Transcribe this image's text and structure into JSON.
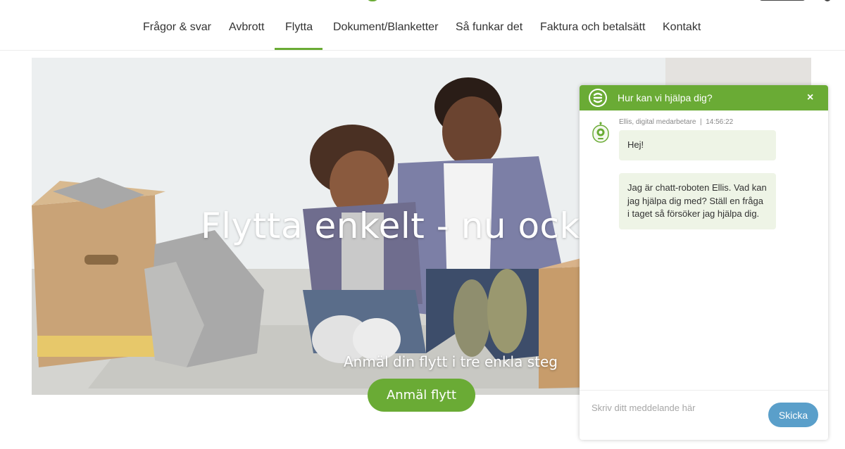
{
  "nav": {
    "items": [
      {
        "label": "Frågor & svar"
      },
      {
        "label": "Avbrott"
      },
      {
        "label": "Flytta",
        "active": true
      },
      {
        "label": "Dokument/Blanketter"
      },
      {
        "label": "Så funkar det"
      },
      {
        "label": "Faktura och betalsätt"
      },
      {
        "label": "Kontakt"
      }
    ]
  },
  "hero": {
    "title": "Flytta enkelt - nu också för före",
    "subtitle": "Anmäl din flytt i tre enkla steg",
    "cta_label": "Anmäl flytt"
  },
  "chat": {
    "header_title": "Hur kan vi hjälpa dig?",
    "close_glyph": "×",
    "meta": "Ellis, digital medarbetare  |  14:56:22",
    "messages": [
      {
        "text": "Hej!"
      },
      {
        "text": "Jag är chatt-roboten Ellis. Vad kan jag hjälpa dig med? Ställ en fråga i taget så försöker jag hjälpa dig."
      }
    ],
    "input_placeholder": "Skriv ditt meddelande här",
    "send_label": "Skicka"
  },
  "colors": {
    "brand_green": "#6aab35",
    "send_blue": "#5a9fca",
    "bubble_bg": "#eef4e6"
  },
  "icons": {
    "chat_logo": "e-logo-icon",
    "bot_avatar": "robot-avatar-icon",
    "close": "close-icon"
  }
}
